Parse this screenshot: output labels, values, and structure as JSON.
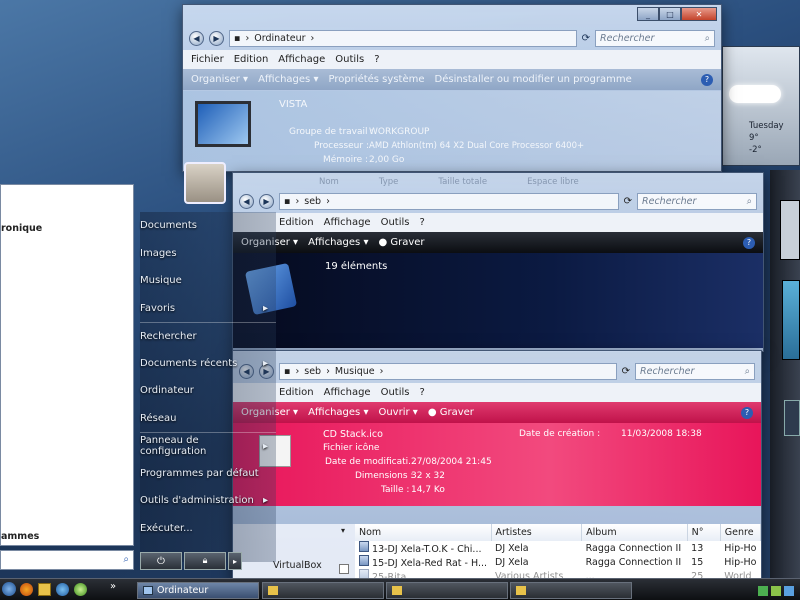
{
  "window1": {
    "breadcrumb": "Ordinateur",
    "search_placeholder": "Rechercher",
    "menu": [
      "Fichier",
      "Edition",
      "Affichage",
      "Outils",
      "?"
    ],
    "toolbar": {
      "organize": "Organiser",
      "views": "Affichages",
      "system_props": "Propriétés système",
      "uninstall": "Désinstaller ou modifier un programme"
    },
    "computer_name": "VISTA",
    "workgroup_label": "Groupe de travail :",
    "workgroup_value": "WORKGROUP",
    "cpu_label": "Processeur :",
    "cpu_value": "AMD Athlon(tm) 64 X2 Dual Core Processor 6400+",
    "memory_label": "Mémoire :",
    "memory_value": "2,00 Go"
  },
  "weather": {
    "day": "Tuesday",
    "high": "9°",
    "low": "-2°"
  },
  "window2": {
    "breadcrumb": "seb",
    "search_placeholder": "Rechercher",
    "menu": [
      "Edition",
      "Affichage",
      "Outils",
      "?"
    ],
    "toolbar": {
      "organize": "Organiser",
      "views": "Affichages",
      "burn": "Graver"
    },
    "item_count": "19 éléments",
    "faded_headers": [
      "Nom",
      "Type",
      "Taille totale",
      "Espace libre"
    ]
  },
  "window3": {
    "breadcrumb": [
      "seb",
      "Musique"
    ],
    "search_placeholder": "Rechercher",
    "menu": [
      "Edition",
      "Affichage",
      "Outils",
      "?"
    ],
    "toolbar": {
      "organize": "Organiser",
      "views": "Affichages",
      "open": "Ouvrir",
      "burn": "Graver"
    },
    "details": {
      "filename": "CD Stack.ico",
      "created_label": "Date de création :",
      "created_value": "11/03/2008 18:38",
      "filetype": "Fichier icône",
      "modified_label": "Date de modificati...",
      "modified_value": "27/08/2004 21:45",
      "dimensions_label": "Dimensions :",
      "dimensions_value": "32 x 32",
      "size_label": "Taille :",
      "size_value": "14,7 Ko"
    },
    "columns": [
      "Nom",
      "Artistes",
      "Album",
      "N°",
      "Genre"
    ],
    "rows": [
      {
        "name": "13-DJ Xela-T.O.K - Chi...",
        "artist": "DJ Xela",
        "album": "Ragga Connection II",
        "num": "13",
        "genre": "Hip-Ho"
      },
      {
        "name": "15-DJ Xela-Red Rat - H...",
        "artist": "DJ Xela",
        "album": "Ragga Connection II",
        "num": "15",
        "genre": "Hip-Ho"
      },
      {
        "name": "25-Rita...",
        "artist": "Various Artists",
        "album": "...",
        "num": "25",
        "genre": "World"
      }
    ],
    "nav_item": "VirtualBox"
  },
  "startmenu": {
    "left_top_item": "ronique",
    "all_programs": "ammes",
    "right_items": [
      {
        "label": "Documents",
        "arrow": false
      },
      {
        "label": "Images",
        "arrow": false
      },
      {
        "label": "Musique",
        "arrow": false
      },
      {
        "label": "Favoris",
        "arrow": true
      },
      {
        "label": "Rechercher",
        "arrow": false
      },
      {
        "label": "Documents récents",
        "arrow": true
      },
      {
        "label": "Ordinateur",
        "arrow": false
      },
      {
        "label": "Réseau",
        "arrow": false
      },
      {
        "label": "Panneau de configuration",
        "arrow": true
      },
      {
        "label": "Programmes par défaut",
        "arrow": false
      },
      {
        "label": "Outils d'administration",
        "arrow": true
      },
      {
        "label": "Exécuter...",
        "arrow": false
      }
    ]
  },
  "taskbar": {
    "active_window": "Ordinateur"
  },
  "colors": {
    "accent_pink": "#e8155a",
    "dark_band": "#0b1430",
    "taskbar": "#16181c"
  }
}
